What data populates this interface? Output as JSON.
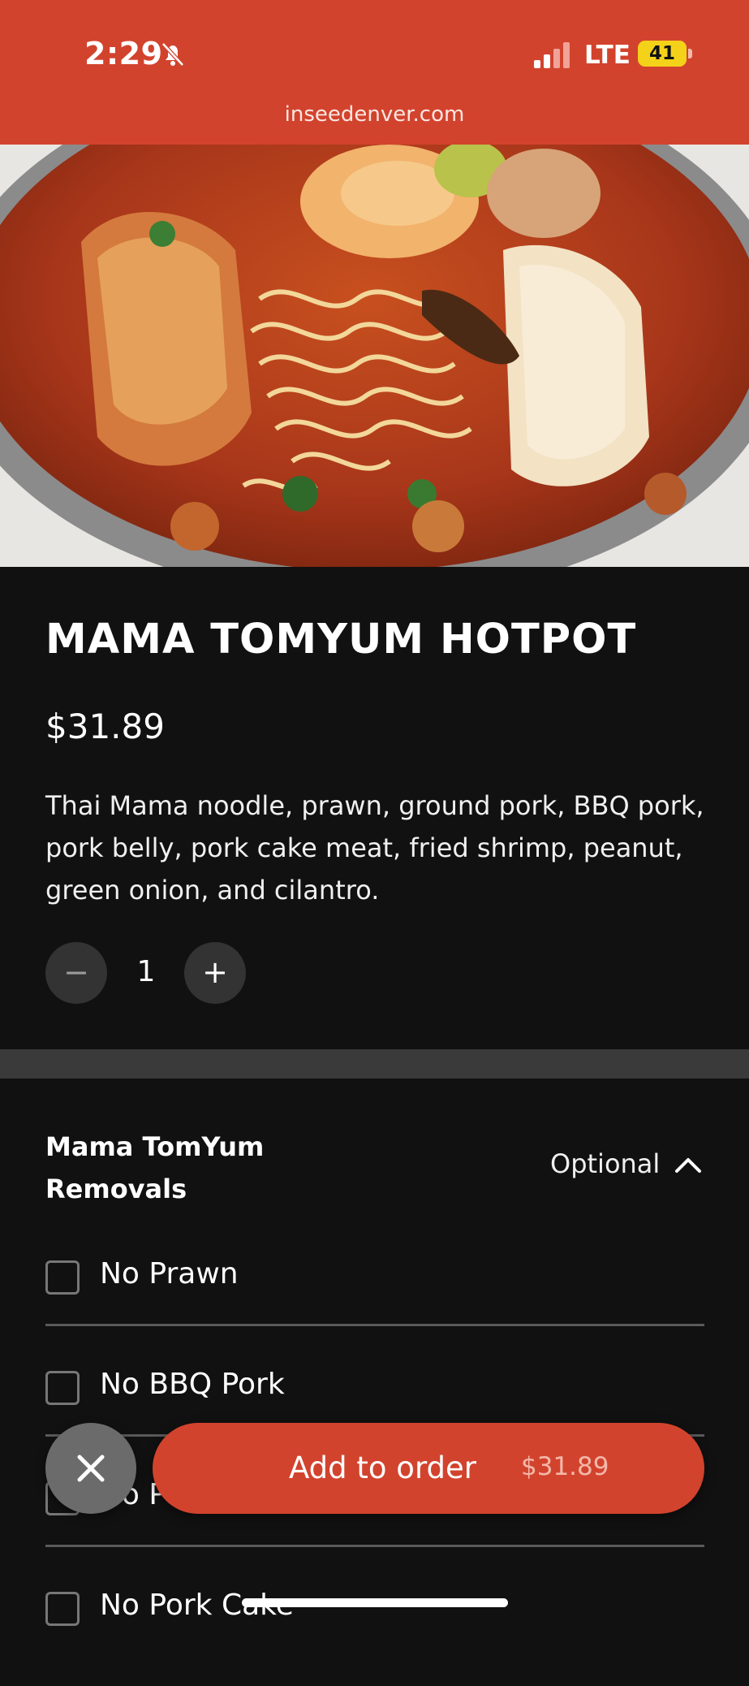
{
  "status_bar": {
    "time": "2:29",
    "network": "LTE",
    "battery": "41",
    "accent": "#d2432d",
    "battery_color": "#f4d21a"
  },
  "browser": {
    "url": "inseedenver.com"
  },
  "item": {
    "title": "MAMA TOMYUM HOTPOT",
    "price": "$31.89",
    "description": "Thai Mama noodle, prawn, ground pork, BBQ pork, pork belly, pork cake meat, fried shrimp, peanut, green onion, and cilantro.",
    "quantity": "1",
    "minus_symbol": "−",
    "plus_symbol": "+"
  },
  "modifiers": {
    "group_title": "Mama TomYum Removals",
    "requirement": "Optional",
    "options": [
      {
        "label": "No Prawn",
        "checked": false
      },
      {
        "label": "No BBQ Pork",
        "checked": false
      },
      {
        "label": "No Pork Belly",
        "checked": false
      },
      {
        "label": "No Pork Cake",
        "checked": false
      }
    ]
  },
  "footer": {
    "add_label": "Add to order",
    "add_price": "$31.89"
  },
  "icons": [
    "bell-slash-icon",
    "signal-icon",
    "battery-icon",
    "chevron-up-icon",
    "close-icon",
    "minus-icon",
    "plus-icon"
  ]
}
